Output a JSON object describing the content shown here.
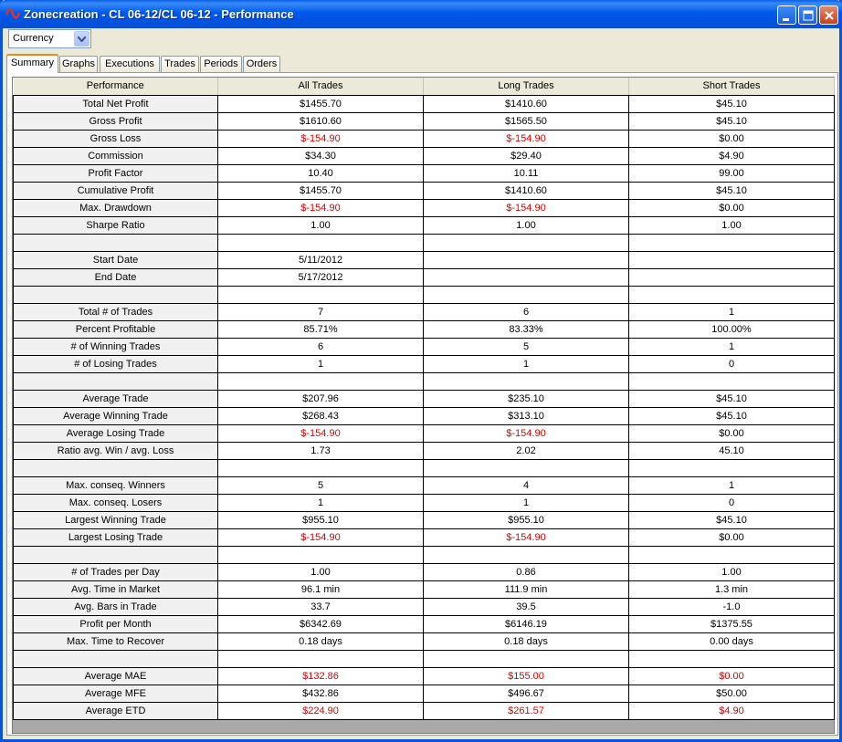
{
  "window": {
    "title": "Zonecreation - CL 06-12/CL 06-12 - Performance"
  },
  "toolbar": {
    "currency_select": {
      "value": "Currency"
    }
  },
  "tabs": [
    {
      "label": "Summary",
      "active": true
    },
    {
      "label": "Graphs"
    },
    {
      "label": "Executions"
    },
    {
      "label": "Trades"
    },
    {
      "label": "Periods"
    },
    {
      "label": "Orders"
    }
  ],
  "table": {
    "columns": [
      "Performance",
      "All Trades",
      "Long Trades",
      "Short Trades"
    ],
    "rows": [
      {
        "label": "Total Net Profit",
        "all": "$1455.70",
        "long": "$1410.60",
        "short": "$45.10"
      },
      {
        "label": "Gross Profit",
        "all": "$1610.60",
        "long": "$1565.50",
        "short": "$45.10"
      },
      {
        "label": "Gross Loss",
        "all": "$-154.90",
        "long": "$-154.90",
        "short": "$0.00",
        "neg": [
          "all",
          "long"
        ]
      },
      {
        "label": "Commission",
        "all": "$34.30",
        "long": "$29.40",
        "short": "$4.90"
      },
      {
        "label": "Profit Factor",
        "all": "10.40",
        "long": "10.11",
        "short": "99.00"
      },
      {
        "label": "Cumulative Profit",
        "all": "$1455.70",
        "long": "$1410.60",
        "short": "$45.10"
      },
      {
        "label": "Max. Drawdown",
        "all": "$-154.90",
        "long": "$-154.90",
        "short": "$0.00",
        "neg": [
          "all",
          "long"
        ]
      },
      {
        "label": "Sharpe Ratio",
        "all": "1.00",
        "long": "1.00",
        "short": "1.00"
      },
      {
        "label": "",
        "all": "",
        "long": "",
        "short": ""
      },
      {
        "label": "Start Date",
        "all": "5/11/2012",
        "long": "",
        "short": ""
      },
      {
        "label": "End Date",
        "all": "5/17/2012",
        "long": "",
        "short": ""
      },
      {
        "label": "",
        "all": "",
        "long": "",
        "short": ""
      },
      {
        "label": "Total # of Trades",
        "all": "7",
        "long": "6",
        "short": "1"
      },
      {
        "label": "Percent Profitable",
        "all": "85.71%",
        "long": "83.33%",
        "short": "100.00%"
      },
      {
        "label": "# of Winning Trades",
        "all": "6",
        "long": "5",
        "short": "1"
      },
      {
        "label": "# of Losing Trades",
        "all": "1",
        "long": "1",
        "short": "0"
      },
      {
        "label": "",
        "all": "",
        "long": "",
        "short": ""
      },
      {
        "label": "Average Trade",
        "all": "$207.96",
        "long": "$235.10",
        "short": "$45.10"
      },
      {
        "label": "Average Winning Trade",
        "all": "$268.43",
        "long": "$313.10",
        "short": "$45.10"
      },
      {
        "label": "Average Losing Trade",
        "all": "$-154.90",
        "long": "$-154.90",
        "short": "$0.00",
        "neg": [
          "all",
          "long"
        ]
      },
      {
        "label": "Ratio avg. Win / avg. Loss",
        "all": "1.73",
        "long": "2.02",
        "short": "45.10"
      },
      {
        "label": "",
        "all": "",
        "long": "",
        "short": ""
      },
      {
        "label": "Max. conseq. Winners",
        "all": "5",
        "long": "4",
        "short": "1"
      },
      {
        "label": "Max. conseq. Losers",
        "all": "1",
        "long": "1",
        "short": "0"
      },
      {
        "label": "Largest Winning Trade",
        "all": "$955.10",
        "long": "$955.10",
        "short": "$45.10"
      },
      {
        "label": "Largest Losing Trade",
        "all": "$-154.90",
        "long": "$-154.90",
        "short": "$0.00",
        "neg": [
          "all",
          "long"
        ]
      },
      {
        "label": "",
        "all": "",
        "long": "",
        "short": ""
      },
      {
        "label": "# of Trades per Day",
        "all": "1.00",
        "long": "0.86",
        "short": "1.00"
      },
      {
        "label": "Avg. Time in Market",
        "all": "96.1 min",
        "long": "111.9 min",
        "short": "1.3 min"
      },
      {
        "label": "Avg. Bars in Trade",
        "all": "33.7",
        "long": "39.5",
        "short": "-1.0"
      },
      {
        "label": "Profit per Month",
        "all": "$6342.69",
        "long": "$6146.19",
        "short": "$1375.55"
      },
      {
        "label": "Max. Time to Recover",
        "all": "0.18 days",
        "long": "0.18 days",
        "short": "0.00 days"
      },
      {
        "label": "",
        "all": "",
        "long": "",
        "short": ""
      },
      {
        "label": "Average MAE",
        "all": "$132.86",
        "long": "$155.00",
        "short": "$0.00",
        "neg": [
          "all",
          "long",
          "short"
        ]
      },
      {
        "label": "Average MFE",
        "all": "$432.86",
        "long": "$496.67",
        "short": "$50.00"
      },
      {
        "label": "Average ETD",
        "all": "$224.90",
        "long": "$261.57",
        "short": "$4.90",
        "neg": [
          "all",
          "long",
          "short"
        ]
      }
    ]
  },
  "colors": {
    "negative": "#e00000",
    "title_bar": "#0054e3",
    "active_tab_accent": "#e68b2c"
  }
}
